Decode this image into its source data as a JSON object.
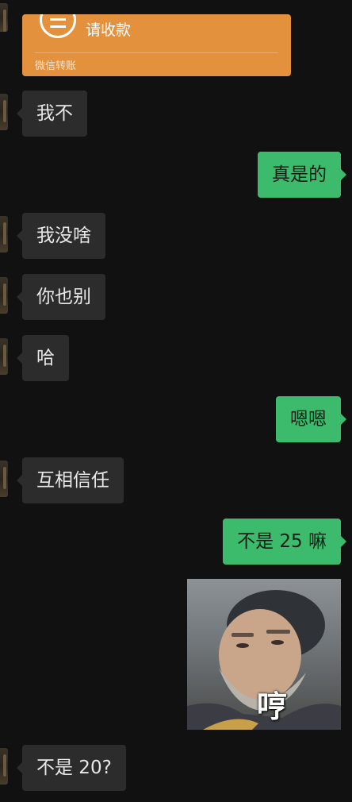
{
  "transfer": {
    "title": "请收款",
    "footer": "微信转账"
  },
  "messages": [
    {
      "side": "left",
      "text": "我不"
    },
    {
      "side": "right",
      "text": "真是的"
    },
    {
      "side": "left",
      "text": "我没啥"
    },
    {
      "side": "left",
      "text": "你也别"
    },
    {
      "side": "left",
      "text": "哈"
    },
    {
      "side": "right",
      "text": "嗯嗯"
    },
    {
      "side": "left",
      "text": "互相信任"
    },
    {
      "side": "right",
      "text": "不是 25 嘛"
    },
    {
      "side": "left",
      "text": "不是 20?"
    }
  ],
  "sticker": {
    "caption": "哼"
  },
  "colors": {
    "background": "#111111",
    "incoming_bubble": "#2c2c2c",
    "outgoing_bubble": "#3dbb6d",
    "transfer_card": "#e3913c"
  }
}
